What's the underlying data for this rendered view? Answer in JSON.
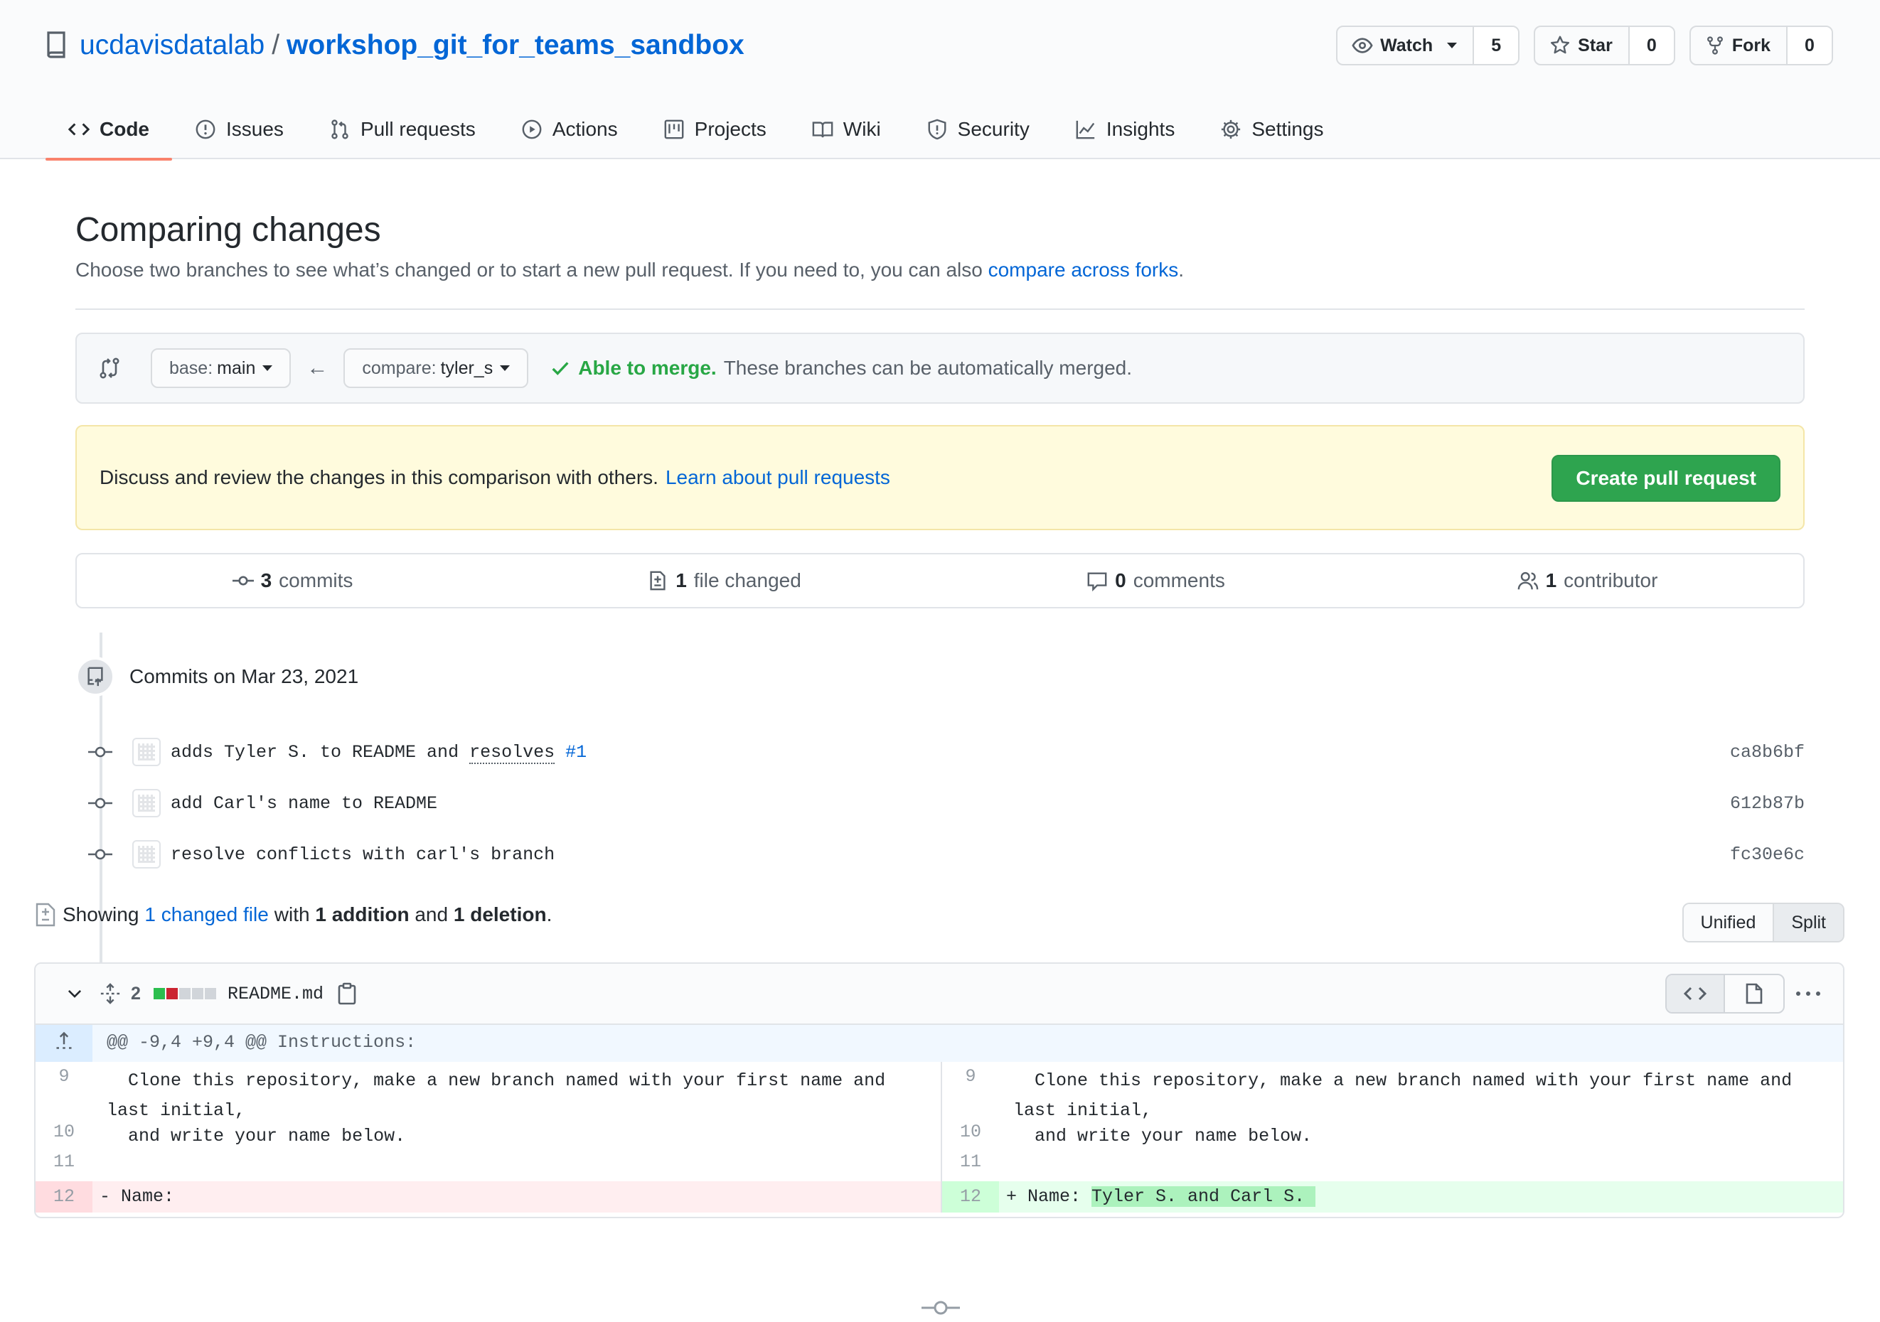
{
  "repo": {
    "owner": "ucdavisdatalab",
    "slash": "/",
    "name": "workshop_git_for_teams_sandbox"
  },
  "actions": {
    "watch_label": "Watch",
    "watch_count": "5",
    "star_label": "Star",
    "star_count": "0",
    "fork_label": "Fork",
    "fork_count": "0"
  },
  "tabs": [
    {
      "label": "Code",
      "icon": "code-icon"
    },
    {
      "label": "Issues",
      "icon": "issue-opened-icon"
    },
    {
      "label": "Pull requests",
      "icon": "git-pull-request-icon"
    },
    {
      "label": "Actions",
      "icon": "play-icon"
    },
    {
      "label": "Projects",
      "icon": "project-icon"
    },
    {
      "label": "Wiki",
      "icon": "book-icon"
    },
    {
      "label": "Security",
      "icon": "shield-icon"
    },
    {
      "label": "Insights",
      "icon": "graph-icon"
    },
    {
      "label": "Settings",
      "icon": "gear-icon"
    }
  ],
  "compare": {
    "title": "Comparing changes",
    "subtitle": "Choose two branches to see what’s changed or to start a new pull request. If you need to, you can also",
    "subtitle_link": "compare across forks",
    "subtitle_end": ".",
    "base_prefix": "base:",
    "base_value": "main",
    "arrow": "←",
    "compare_prefix": "compare:",
    "compare_value": "tyler_s",
    "merge_ok": "Able to merge.",
    "merge_text": "These branches can be automatically merged."
  },
  "flash": {
    "text": "Discuss and review the changes in this comparison with others.",
    "link": "Learn about pull requests",
    "button": "Create pull request"
  },
  "numbers": {
    "commits_count": "3",
    "commits_label": "commits",
    "files_count": "1",
    "files_label": "file changed",
    "comments_count": "0",
    "comments_label": "comments",
    "contributors_count": "1",
    "contributors_label": "contributor"
  },
  "commits": {
    "date_heading": "Commits on Mar 23, 2021",
    "items": [
      {
        "message_a": "adds Tyler S. to README and ",
        "resolves": "resolves",
        "issue": "#1",
        "sha": "ca8b6bf"
      },
      {
        "message_a": "add Carl's name to README",
        "sha": "612b87b"
      },
      {
        "message_a": "resolve conflicts with carl's branch",
        "sha": "fc30e6c"
      }
    ]
  },
  "files_summary": {
    "showing": "Showing",
    "changed_link": "1 changed file",
    "with": "with",
    "additions": "1 addition",
    "and": "and",
    "deletions": "1 deletion",
    "end": "."
  },
  "diff_view": {
    "unified": "Unified",
    "split": "Split",
    "selected": "Split"
  },
  "file": {
    "change_count": "2",
    "name": "README.md",
    "hunk": "@@ -9,4 +9,4 @@ Instructions:",
    "left": [
      {
        "num": "9",
        "code": "  Clone this repository, make a new branch named with your first name and last initial,"
      },
      {
        "num": "10",
        "code": "  and write your name below."
      },
      {
        "num": "11",
        "code": ""
      },
      {
        "num": "12",
        "code": "- Name:"
      }
    ],
    "right": [
      {
        "num": "9",
        "code": "  Clone this repository, make a new branch named with your first name and last initial,"
      },
      {
        "num": "10",
        "code": "  and write your name below."
      },
      {
        "num": "11",
        "code": ""
      },
      {
        "num": "12",
        "code_prefix": "+ Name: ",
        "code_hl": "Tyler S. and Carl S. "
      }
    ]
  },
  "colors": {
    "link": "#0366d6",
    "success": "#28a745",
    "create_button": "#2ea44f",
    "tab_underline": "#f9826c"
  }
}
